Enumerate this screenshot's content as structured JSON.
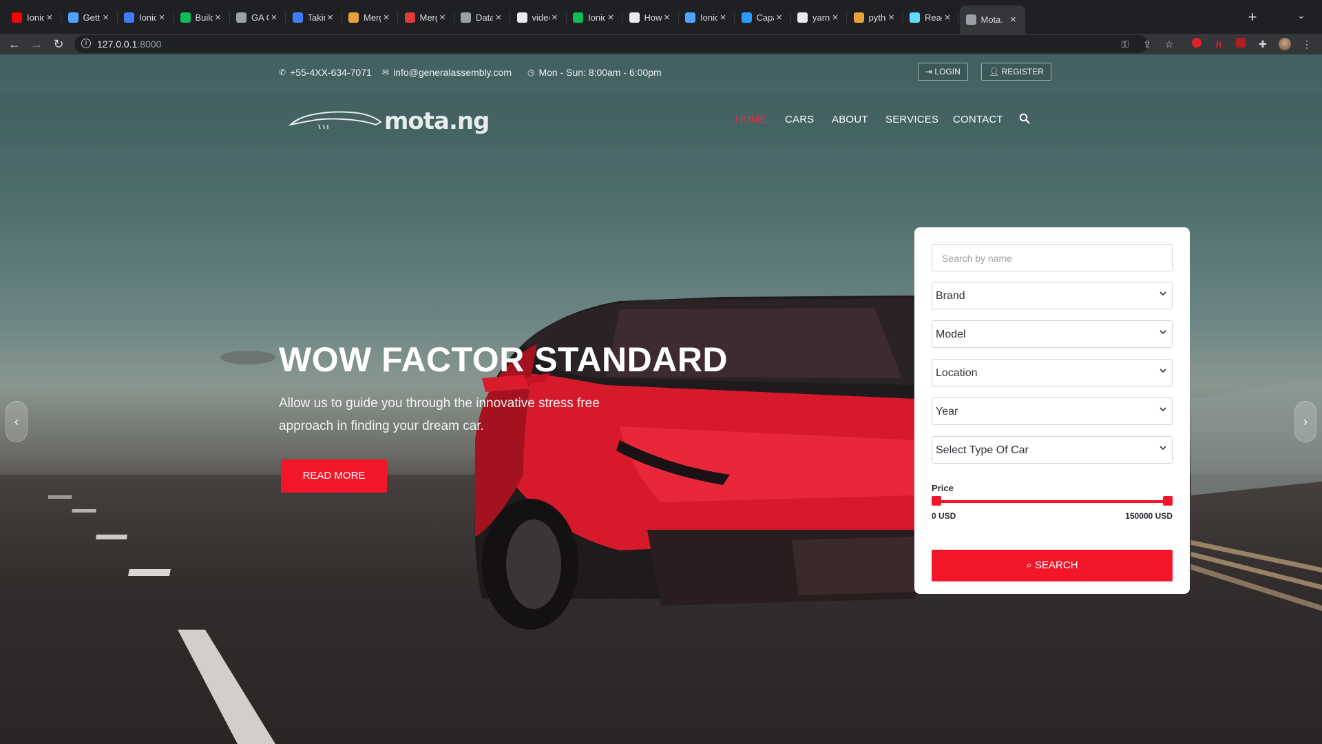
{
  "browser": {
    "tabs": [
      {
        "title": "Ionic F",
        "color": "#ff0000"
      },
      {
        "title": "Gettin",
        "color": "#4da3ff"
      },
      {
        "title": "Ionic C",
        "color": "#3f7df6"
      },
      {
        "title": "Build /",
        "color": "#0fbd59"
      },
      {
        "title": "GA Ca",
        "color": "#9aa0a6"
      },
      {
        "title": "Taking",
        "color": "#3f7df6"
      },
      {
        "title": "Merge",
        "color": "#e8a13a"
      },
      {
        "title": "Merge",
        "color": "#e23b3b"
      },
      {
        "title": "Data S",
        "color": "#9aa0a6"
      },
      {
        "title": "videos",
        "color": "#e8eaed"
      },
      {
        "title": "Ionic E",
        "color": "#0fbd59"
      },
      {
        "title": "How t",
        "color": "#e8eaed"
      },
      {
        "title": "Ionic ‹",
        "color": "#4da3ff"
      },
      {
        "title": "Capac",
        "color": "#2b9cff"
      },
      {
        "title": "yarn ir",
        "color": "#e8eaed"
      },
      {
        "title": "pythor",
        "color": "#e8a13a"
      },
      {
        "title": "React",
        "color": "#61dafb"
      },
      {
        "title": "Mota.",
        "color": "#9aa0a6"
      }
    ],
    "url_host": "127.0.0.1",
    "url_port": ":8000"
  },
  "topbar": {
    "phone": "+55-4XX-634-7071",
    "email": "info@generalassembly.com",
    "hours": "Mon - Sun: 8:00am - 6:00pm",
    "login_label": "LOGIN",
    "register_label": "REGISTER"
  },
  "nav": {
    "logo_text": "mota.ng",
    "links": [
      "HOME",
      "CARS",
      "ABOUT",
      "SERVICES",
      "CONTACT"
    ],
    "active": "HOME"
  },
  "hero": {
    "title": "WOW FACTOR STANDARD",
    "subtitle": "Allow us to guide you through the innovative stress free approach in finding your dream car.",
    "cta_label": "READ MORE"
  },
  "search_form": {
    "name_placeholder": "Search by name",
    "brand": "Brand",
    "model": "Model",
    "location": "Location",
    "year": "Year",
    "car_type": "Select Type Of Car",
    "price_label": "Price",
    "price_min": "0 USD",
    "price_max": "150000 USD",
    "search_label": "SEARCH"
  },
  "colors": {
    "accent": "#f3152a",
    "nav_active": "#e8303d"
  }
}
